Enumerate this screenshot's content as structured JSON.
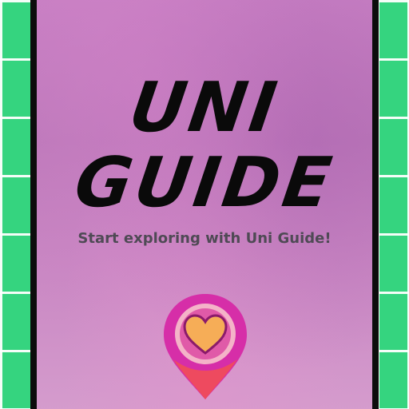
{
  "app": {
    "title_line1": "UNI",
    "title_line2": "GUIDE",
    "tagline": "Start exploring with Uni Guide!"
  },
  "icons": {
    "logo_pin": "location-pin-heart-icon"
  },
  "colors": {
    "side_green": "#35d47f",
    "background_pink": "#c77fc3",
    "pin_magenta": "#d62ea8",
    "pin_red": "#ee4a5f",
    "heart_orange": "#f6ad57"
  }
}
